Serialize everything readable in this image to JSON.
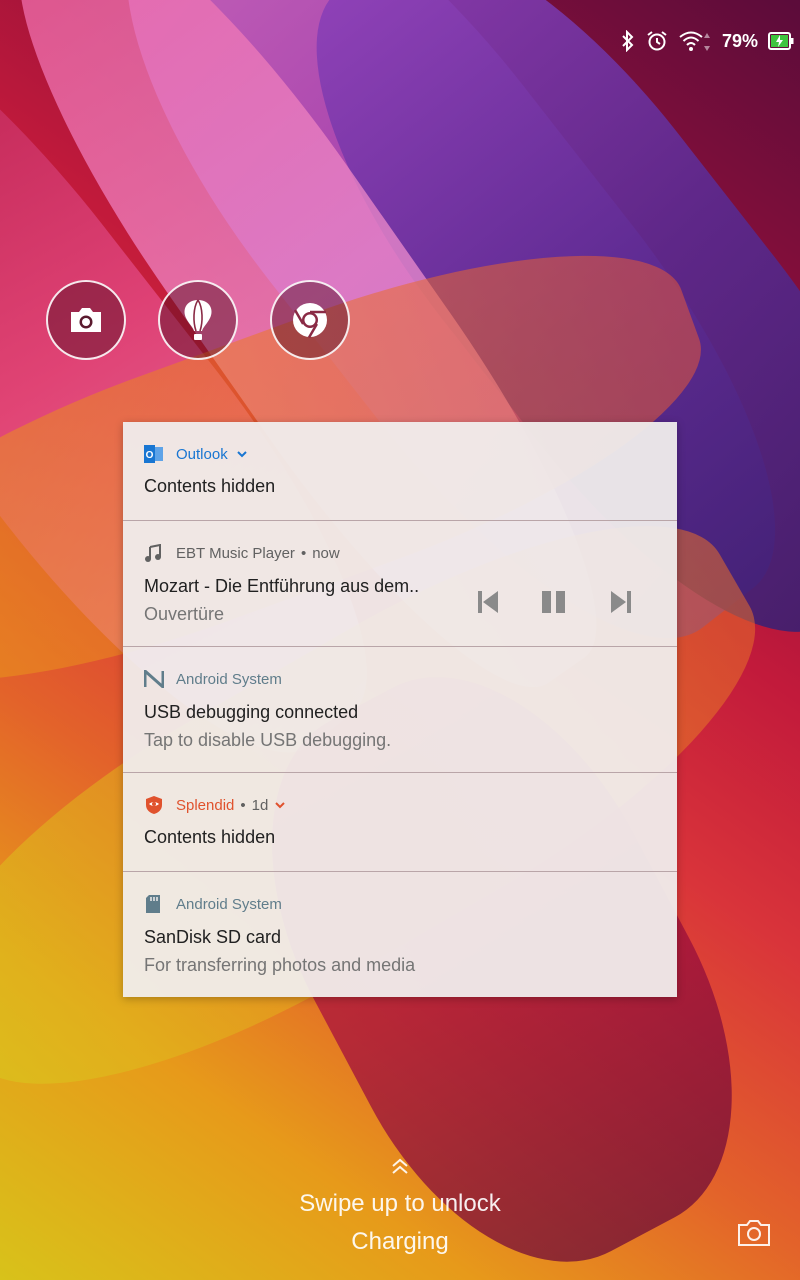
{
  "status_bar": {
    "battery_percent": "79%",
    "icons": [
      "bluetooth-icon",
      "alarm-icon",
      "wifi-icon",
      "battery-charging-icon"
    ]
  },
  "shortcuts": [
    {
      "name": "camera",
      "icon": "camera-icon"
    },
    {
      "name": "balloon",
      "icon": "balloon-icon"
    },
    {
      "name": "chrome",
      "icon": "chrome-icon"
    }
  ],
  "notifications": [
    {
      "app": "Outlook",
      "app_color": "#1976d2",
      "title": "Contents hidden"
    },
    {
      "app": "EBT Music Player",
      "time": "now",
      "title": "Mozart - Die Entführung aus dem..",
      "text": "Ouvertüre"
    },
    {
      "app": "Android System",
      "app_color": "#607d8b",
      "title": "USB debugging connected",
      "text": "Tap to disable USB debugging."
    },
    {
      "app": "Splendid",
      "app_color": "#e0522d",
      "time": "1d",
      "title": "Contents hidden"
    },
    {
      "app": "Android System",
      "app_color": "#607d8b",
      "title": "SanDisk SD card",
      "text": "For transferring photos and media"
    }
  ],
  "lockscreen": {
    "swipe_hint": "Swipe up to unlock",
    "charging": "Charging"
  }
}
